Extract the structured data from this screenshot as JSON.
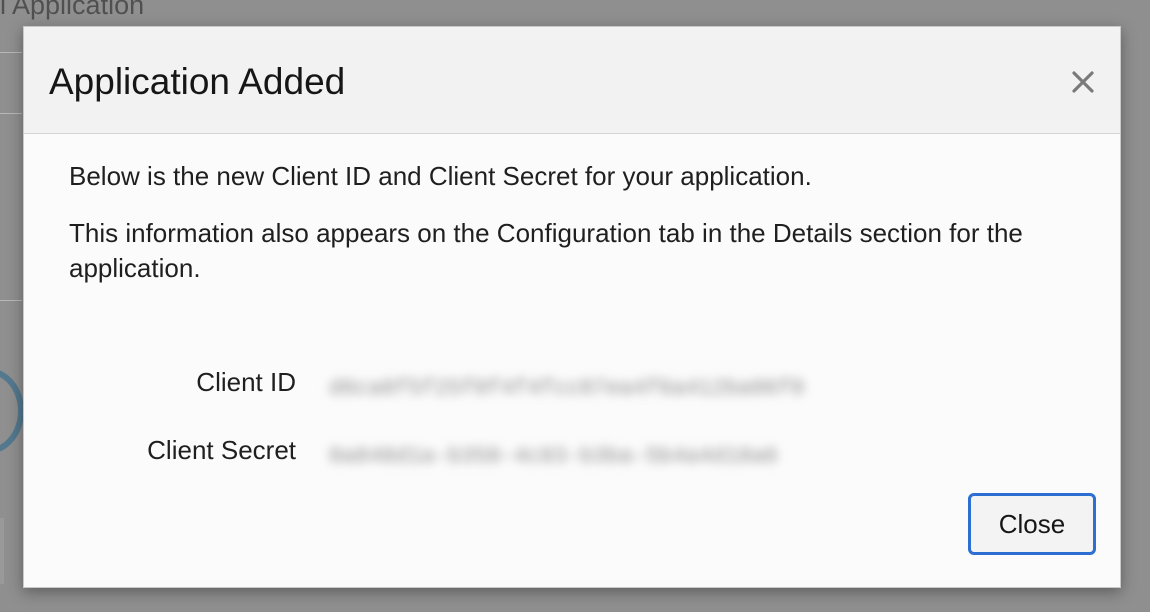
{
  "background": {
    "title_fragment": "l Application"
  },
  "dialog": {
    "title": "Application Added",
    "close_icon": "close-icon",
    "intro": "Below is the new Client ID and Client Secret for your application.",
    "note": "This information also appears on the Configuration tab in the Details section for the application.",
    "client_id_label": "Client ID",
    "client_id_value": "d6ca8f5f25f0f4f4fcc07ea4f6a412ba06f0",
    "client_secret_label": "Client Secret",
    "client_secret_value": "0a848d1a-b358-4c83-b3ba-5b4a4d18a6",
    "close_button_label": "Close",
    "accent_color": "#2a6fd1"
  }
}
